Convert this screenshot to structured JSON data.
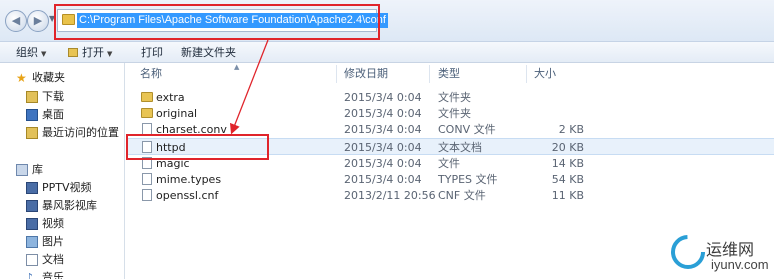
{
  "address_bar": {
    "path": "C:\\Program Files\\Apache Software Foundation\\Apache2.4\\conf"
  },
  "toolbar": {
    "organize_label": "组织",
    "open_label": "打开",
    "print_label": "打印",
    "new_folder_label": "新建文件夹"
  },
  "sidebar": {
    "favorites": {
      "label": "收藏夹",
      "items": [
        {
          "label": "下载",
          "icon": "download-folder-icon"
        },
        {
          "label": "桌面",
          "icon": "desktop-icon"
        },
        {
          "label": "最近访问的位置",
          "icon": "recent-places-icon"
        }
      ]
    },
    "libraries": {
      "label": "库",
      "items": [
        {
          "label": "PPTV视频",
          "icon": "video-library-icon"
        },
        {
          "label": "暴风影视库",
          "icon": "video-library-icon"
        },
        {
          "label": "视频",
          "icon": "video-library-icon"
        },
        {
          "label": "图片",
          "icon": "picture-library-icon"
        },
        {
          "label": "文档",
          "icon": "document-library-icon"
        },
        {
          "label": "音乐",
          "icon": "music-library-icon"
        }
      ]
    }
  },
  "file_list": {
    "columns": {
      "name": "名称",
      "date": "修改日期",
      "type": "类型",
      "size": "大小"
    },
    "rows": [
      {
        "name": "extra",
        "date": "2015/3/4 0:04",
        "type": "文件夹",
        "size": "",
        "kind": "folder"
      },
      {
        "name": "original",
        "date": "2015/3/4 0:04",
        "type": "文件夹",
        "size": "",
        "kind": "folder"
      },
      {
        "name": "charset.conv",
        "date": "2015/3/4 0:04",
        "type": "CONV 文件",
        "size": "2 KB",
        "kind": "file"
      },
      {
        "name": "httpd",
        "date": "2015/3/4 0:04",
        "type": "文本文档",
        "size": "20 KB",
        "kind": "file"
      },
      {
        "name": "magic",
        "date": "2015/3/4 0:04",
        "type": "文件",
        "size": "14 KB",
        "kind": "file"
      },
      {
        "name": "mime.types",
        "date": "2015/3/4 0:04",
        "type": "TYPES 文件",
        "size": "54 KB",
        "kind": "file"
      },
      {
        "name": "openssl.cnf",
        "date": "2013/2/11 20:56",
        "type": "CNF 文件",
        "size": "11 KB",
        "kind": "file"
      }
    ]
  },
  "watermark": {
    "text": "运维网",
    "url": "iyunv.com"
  },
  "colors": {
    "annotation_red": "#e0242b",
    "selection_blue": "#3399ff"
  }
}
